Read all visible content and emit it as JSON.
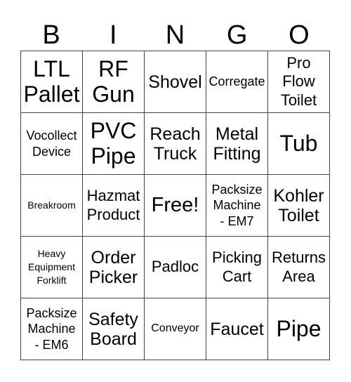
{
  "header": {
    "letters": [
      "B",
      "I",
      "N",
      "G",
      "O"
    ]
  },
  "card": {
    "rows": [
      [
        "LTL\nPallet",
        "RF\nGun",
        "Shovel",
        "Corregate",
        "Pro\nFlow\nToilet"
      ],
      [
        "Vocollect\nDevice",
        "PVC\nPipe",
        "Reach\nTruck",
        "Metal\nFitting",
        "Tub"
      ],
      [
        "Breakroom",
        "Hazmat\nProduct",
        "Free!",
        "Packsize\nMachine\n- EM7",
        "Kohler\nToilet"
      ],
      [
        "Heavy\nEquipment\nForklift",
        "Order\nPicker",
        "Padloc",
        "Picking\nCart",
        "Returns\nArea"
      ],
      [
        "Packsize\nMachine\n- EM6",
        "Safety\nBoard",
        "Conveyor",
        "Faucet",
        "Pipe"
      ]
    ]
  }
}
